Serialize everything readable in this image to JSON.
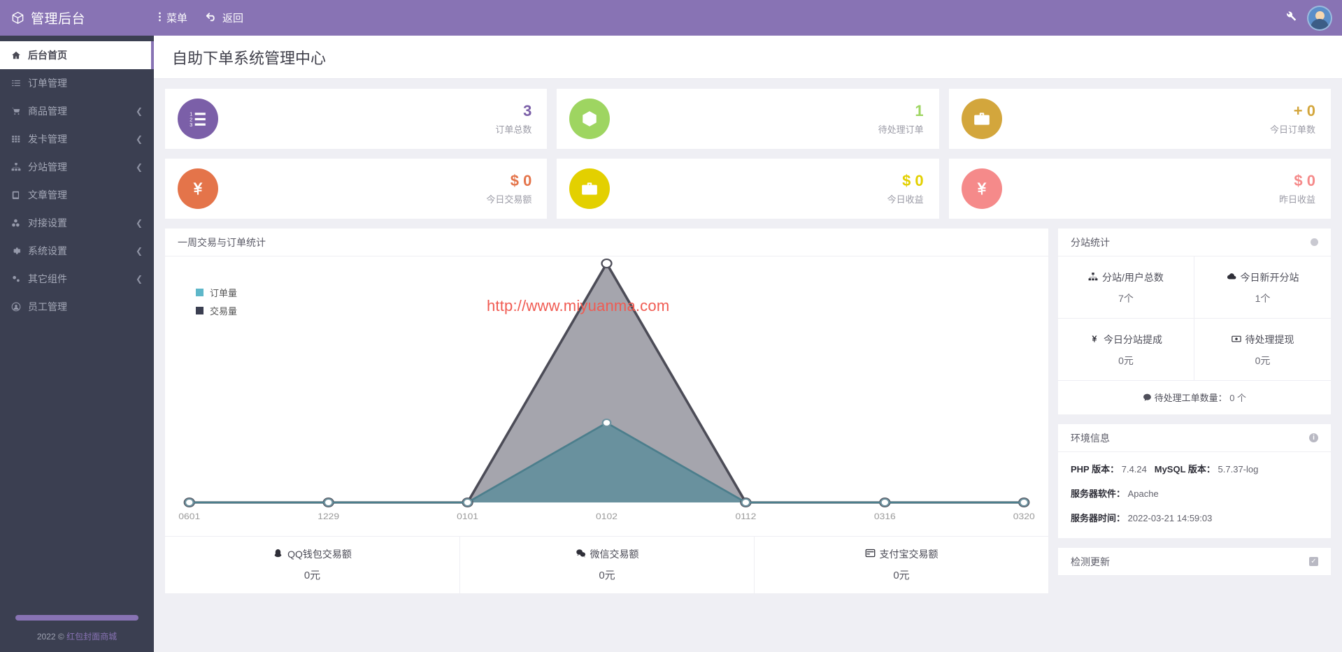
{
  "topbar": {
    "brand": "管理后台",
    "brand_icon": "cube-icon",
    "nav": [
      {
        "label": "菜单",
        "icon": "dots-vertical-icon"
      },
      {
        "label": "返回",
        "icon": "undo-arrow-icon"
      }
    ],
    "wrench_icon": "wrench-icon",
    "avatar_icon": "user-avatar"
  },
  "sidebar": {
    "items": [
      {
        "label": "后台首页",
        "icon": "home-icon",
        "active": true,
        "expandable": false
      },
      {
        "label": "订单管理",
        "icon": "list-icon",
        "active": false,
        "expandable": false
      },
      {
        "label": "商品管理",
        "icon": "cart-icon",
        "active": false,
        "expandable": true
      },
      {
        "label": "发卡管理",
        "icon": "grid-icon",
        "active": false,
        "expandable": true
      },
      {
        "label": "分站管理",
        "icon": "sitemap-icon",
        "active": false,
        "expandable": true
      },
      {
        "label": "文章管理",
        "icon": "book-icon",
        "active": false,
        "expandable": false
      },
      {
        "label": "对接设置",
        "icon": "nodes-icon",
        "active": false,
        "expandable": true
      },
      {
        "label": "系统设置",
        "icon": "gear-icon",
        "active": false,
        "expandable": true
      },
      {
        "label": "其它组件",
        "icon": "cogs-icon",
        "active": false,
        "expandable": true
      },
      {
        "label": "员工管理",
        "icon": "user-circle-icon",
        "active": false,
        "expandable": false
      }
    ],
    "footer": {
      "year": "2022 ©",
      "link": "红包封面商城"
    }
  },
  "page": {
    "title": "自助下单系统管理中心"
  },
  "stats": [
    {
      "value": "3",
      "label": "订单总数",
      "color": "#7b5fa8",
      "icon": "ordered-list-icon"
    },
    {
      "value": "1",
      "label": "待处理订单",
      "color": "#9ed561",
      "icon": "cube-icon"
    },
    {
      "value": "+ 0",
      "label": "今日订单数",
      "color": "#d3a63c",
      "icon": "briefcase-icon"
    },
    {
      "value": "$ 0",
      "label": "今日交易额",
      "color": "#e4744a",
      "icon": "yen-icon"
    },
    {
      "value": "$ 0",
      "label": "今日收益",
      "color": "#e3d000",
      "icon": "briefcase-icon"
    },
    {
      "value": "$ 0",
      "label": "昨日收益",
      "color": "#f58a8a",
      "icon": "yen-icon"
    }
  ],
  "chart_panel": {
    "title": "一周交易与订单统计",
    "watermark": "http://www.miyuanma.com"
  },
  "chart_data": {
    "type": "area",
    "title": "一周交易与订单统计",
    "xlabel": "",
    "ylabel": "",
    "grid": false,
    "legend_position": "top-left",
    "categories": [
      "0601",
      "1229",
      "0101",
      "0102",
      "0112",
      "0316",
      "0320"
    ],
    "series": [
      {
        "name": "订单量",
        "color": "#5eb7c9",
        "fill": "#5f8e9b",
        "values": [
          0,
          0,
          0,
          1,
          0,
          0,
          0
        ]
      },
      {
        "name": "交易量",
        "color": "#3b3f51",
        "fill": "#8c8c96",
        "values": [
          0,
          0,
          0,
          3,
          0,
          0,
          0
        ]
      }
    ],
    "ylim": [
      0,
      3
    ]
  },
  "payments": [
    {
      "title": "QQ钱包交易额",
      "value": "0元",
      "icon": "qq-penguin-icon"
    },
    {
      "title": "微信交易额",
      "value": "0元",
      "icon": "wechat-icon"
    },
    {
      "title": "支付宝交易额",
      "value": "0元",
      "icon": "alipay-card-icon"
    }
  ],
  "substation": {
    "title": "分站统计",
    "header_icon": "circle-dot-icon",
    "cells": [
      {
        "title": "分站/用户总数",
        "value": "7个",
        "icon": "sitemap-icon"
      },
      {
        "title": "今日新开分站",
        "value": "1个",
        "icon": "cloud-icon"
      },
      {
        "title": "今日分站提成",
        "value": "0元",
        "icon": "yen-icon"
      },
      {
        "title": "待处理提现",
        "value": "0元",
        "icon": "money-bill-icon"
      }
    ],
    "footer_label": "待处理工单数量：",
    "footer_value": "0 个",
    "footer_icon": "comment-icon"
  },
  "environment": {
    "title": "环境信息",
    "header_icon": "info-icon",
    "lines": [
      {
        "label": "PHP 版本：",
        "value": "7.4.24",
        "label2": "MySQL 版本：",
        "value2": "5.7.37-log"
      },
      {
        "label": "服务器软件：",
        "value": "Apache"
      },
      {
        "label": "服务器时间：",
        "value": "2022-03-21 14:59:03"
      }
    ]
  },
  "update_panel": {
    "title": "检测更新",
    "header_icon": "checkbox-icon"
  }
}
